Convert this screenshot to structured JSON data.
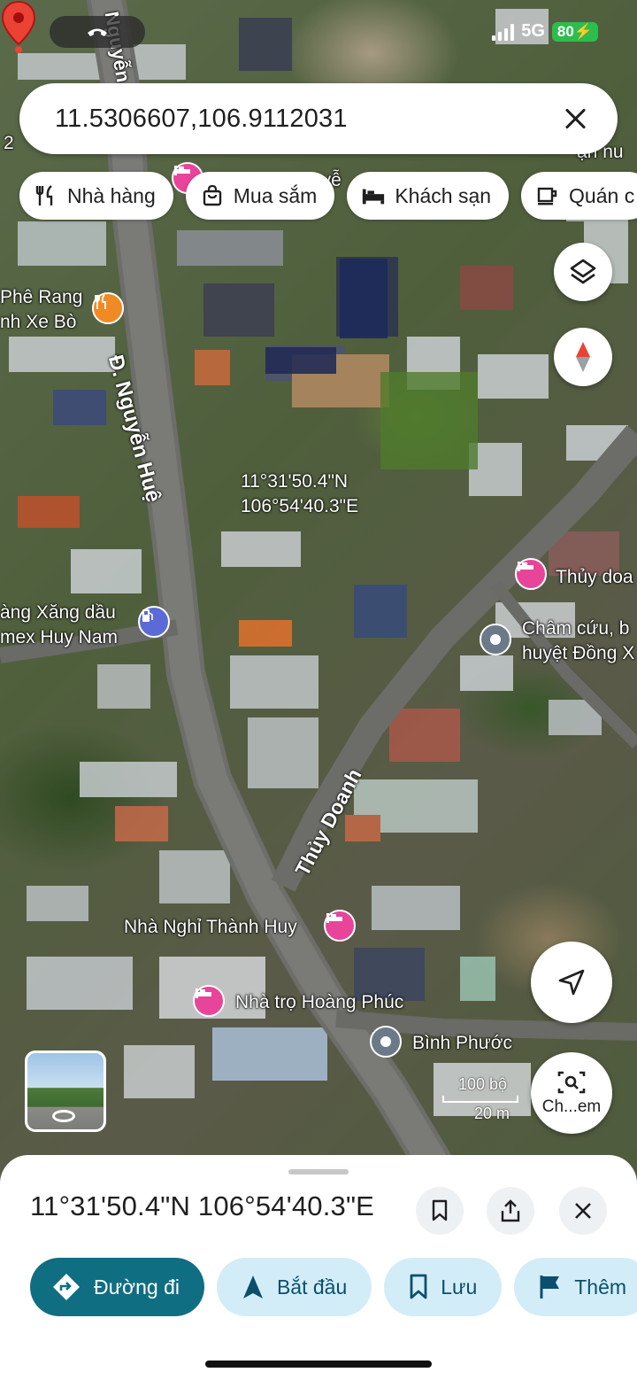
{
  "status_bar": {
    "network": "5G",
    "battery": "80"
  },
  "search": {
    "query": "11.5306607,106.9112031"
  },
  "chips": [
    {
      "label": "Nhà hàng",
      "icon": "fork-knife-icon"
    },
    {
      "label": "Mua sắm",
      "icon": "shopping-bag-icon"
    },
    {
      "label": "Khách sạn",
      "icon": "bed-icon"
    },
    {
      "label": "Quán c",
      "icon": "coffee-cup-icon"
    }
  ],
  "map": {
    "pin_coords": {
      "lat": "11°31'50.4\"N",
      "lng": "106°54'40.3\"E"
    },
    "roads": {
      "main": "Đ. Nguyễn Huệ",
      "side": "Thủy Doanh",
      "top": "Nguyễn"
    },
    "places": {
      "cafe_line1": "Phê Rang",
      "cafe_line2": "nh Xe Bò",
      "gas_line1": "àng Xăng dầu",
      "gas_line2": "mex Huy Nam",
      "hotel_right": "Thủy doa",
      "clinic_line1": "Châm cứu, b",
      "clinic_line2": "huyệt Đồng X",
      "guest_house": "Nhà Nghỉ Thành Huy",
      "motel": "Nhà trọ Hoàng Phúc",
      "province": "Bình Phước",
      "edge_left": "2",
      "edge_top_right": "ận nu",
      "edge_top_mid": "uyễ"
    },
    "scale": {
      "top": "100 bộ",
      "bottom": "20 m"
    },
    "lens_label": "Ch...em"
  },
  "sheet": {
    "title": "11°31'50.4\"N 106°54'40.3\"E",
    "actions": [
      {
        "label": "Đường đi",
        "icon": "directions-icon",
        "primary": true
      },
      {
        "label": "Bắt đầu",
        "icon": "navigation-arrow-icon"
      },
      {
        "label": "Lưu",
        "icon": "bookmark-icon"
      },
      {
        "label": "Thêm",
        "icon": "flag-icon"
      }
    ]
  }
}
